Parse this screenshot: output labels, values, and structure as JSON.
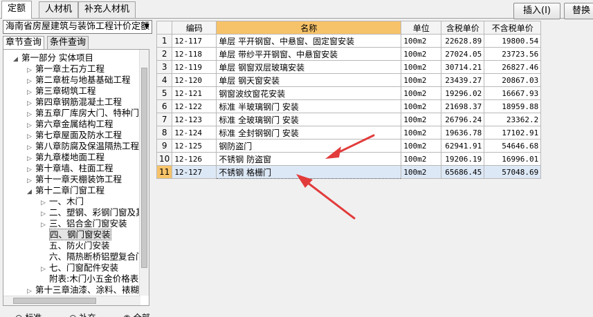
{
  "top_tabs": [
    "定额",
    "人材机",
    "补充人材机"
  ],
  "top_buttons": {
    "insert": "插入(I)",
    "replace": "替换"
  },
  "dropdown": {
    "value": "海南省房屋建筑与装饰工程计价定额"
  },
  "sub_tabs": [
    "章节查询",
    "条件查询"
  ],
  "tree": [
    "第一部分 实体项目",
    "第一章土石方工程",
    "第二章桩与地基基础工程",
    "第三章砌筑工程",
    "第四章钢筋混凝土工程",
    "第五章厂库房大门、特种门",
    "第六章金属结构工程",
    "第七章屋面及防水工程",
    "第八章防腐及保温隔热工程",
    "第九章楼地面工程",
    "第十章墙、柱面工程",
    "第十一章天棚装饰工程",
    "第十二章门窗工程",
    "一、木门",
    "二、塑钢、彩钢门窗及其",
    "三、铝合金门窗安装",
    "四、钢门窗安装",
    "五、防火门安装",
    "六、隔热断桥铝塑复合门",
    "七、门窗配件安装",
    "附表:木门小五金价格表",
    "第十三章油漆、涂料、裱糊"
  ],
  "radio": [
    "标准",
    "补充",
    "全部"
  ],
  "table": {
    "headers": [
      "",
      "编码",
      "名称",
      "单位",
      "含税单价",
      "不含税单价"
    ],
    "rows": [
      [
        "1",
        "12-117",
        "单层 平开钢窗、中悬窗、固定窗安装",
        "100m2",
        "22628.89",
        "19800.54"
      ],
      [
        "2",
        "12-118",
        "单层 带纱平开钢窗、中悬窗安装",
        "100m2",
        "27024.05",
        "23723.56"
      ],
      [
        "3",
        "12-119",
        "单层 钢窗双层玻璃安装",
        "100m2",
        "30714.21",
        "26827.46"
      ],
      [
        "4",
        "12-120",
        "单层 钢天窗安装",
        "100m2",
        "23439.27",
        "20867.03"
      ],
      [
        "5",
        "12-121",
        "钢窗波纹窗花安装",
        "100m2",
        "19296.02",
        "16667.93"
      ],
      [
        "6",
        "12-122",
        "标准 半玻璃钢门 安装",
        "100m2",
        "21698.37",
        "18959.88"
      ],
      [
        "7",
        "12-123",
        "标准 全玻璃钢门 安装",
        "100m2",
        "26796.24",
        "23362.2"
      ],
      [
        "8",
        "12-124",
        "标准 全封钢钢门 安装",
        "100m2",
        "19636.78",
        "17102.91"
      ],
      [
        "9",
        "12-125",
        "钢防盗门",
        "100m2",
        "62941.91",
        "54646.68"
      ],
      [
        "10",
        "12-126",
        "不锈钢 防盗窗",
        "100m2",
        "19206.19",
        "16996.01"
      ],
      [
        "11",
        "12-127",
        "不锈钢 格栅门",
        "100m2",
        "65686.45",
        "57048.69"
      ]
    ]
  },
  "colors": {
    "arrow": "#e23b3b",
    "header_highlight": "#f7c36a",
    "selected_row": "#dde8f6"
  }
}
